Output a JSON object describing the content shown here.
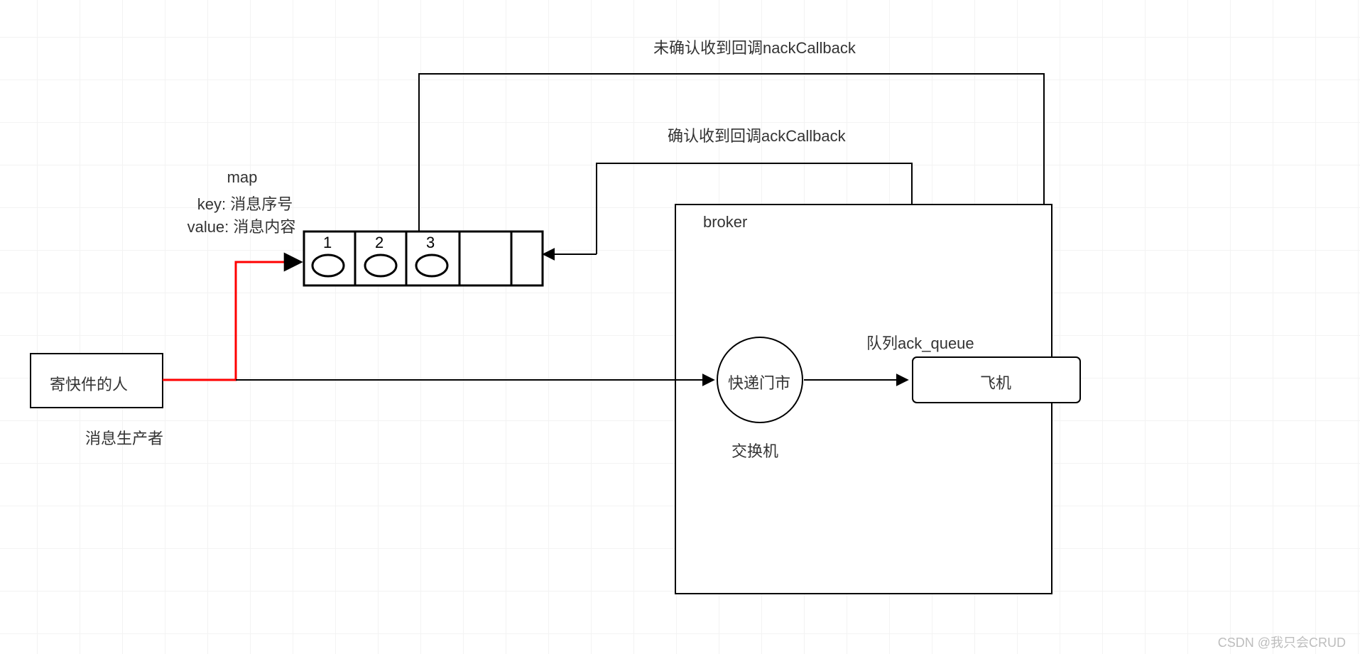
{
  "labels": {
    "nack": "未确认收到回调nackCallback",
    "ack": "确认收到回调ackCallback",
    "map_title": "map",
    "map_key": "key: 消息序号",
    "map_value": "value: 消息内容",
    "cell1": "1",
    "cell2": "2",
    "cell3": "3",
    "sender_box": "寄快件的人",
    "producer_sub": "消息生产者",
    "broker": "broker",
    "exchange_circle": "快递门市",
    "exchange_sub": "交换机",
    "queue_title": "队列ack_queue",
    "queue_box": "飞机",
    "watermark": "CSDN @我只会CRUD"
  }
}
